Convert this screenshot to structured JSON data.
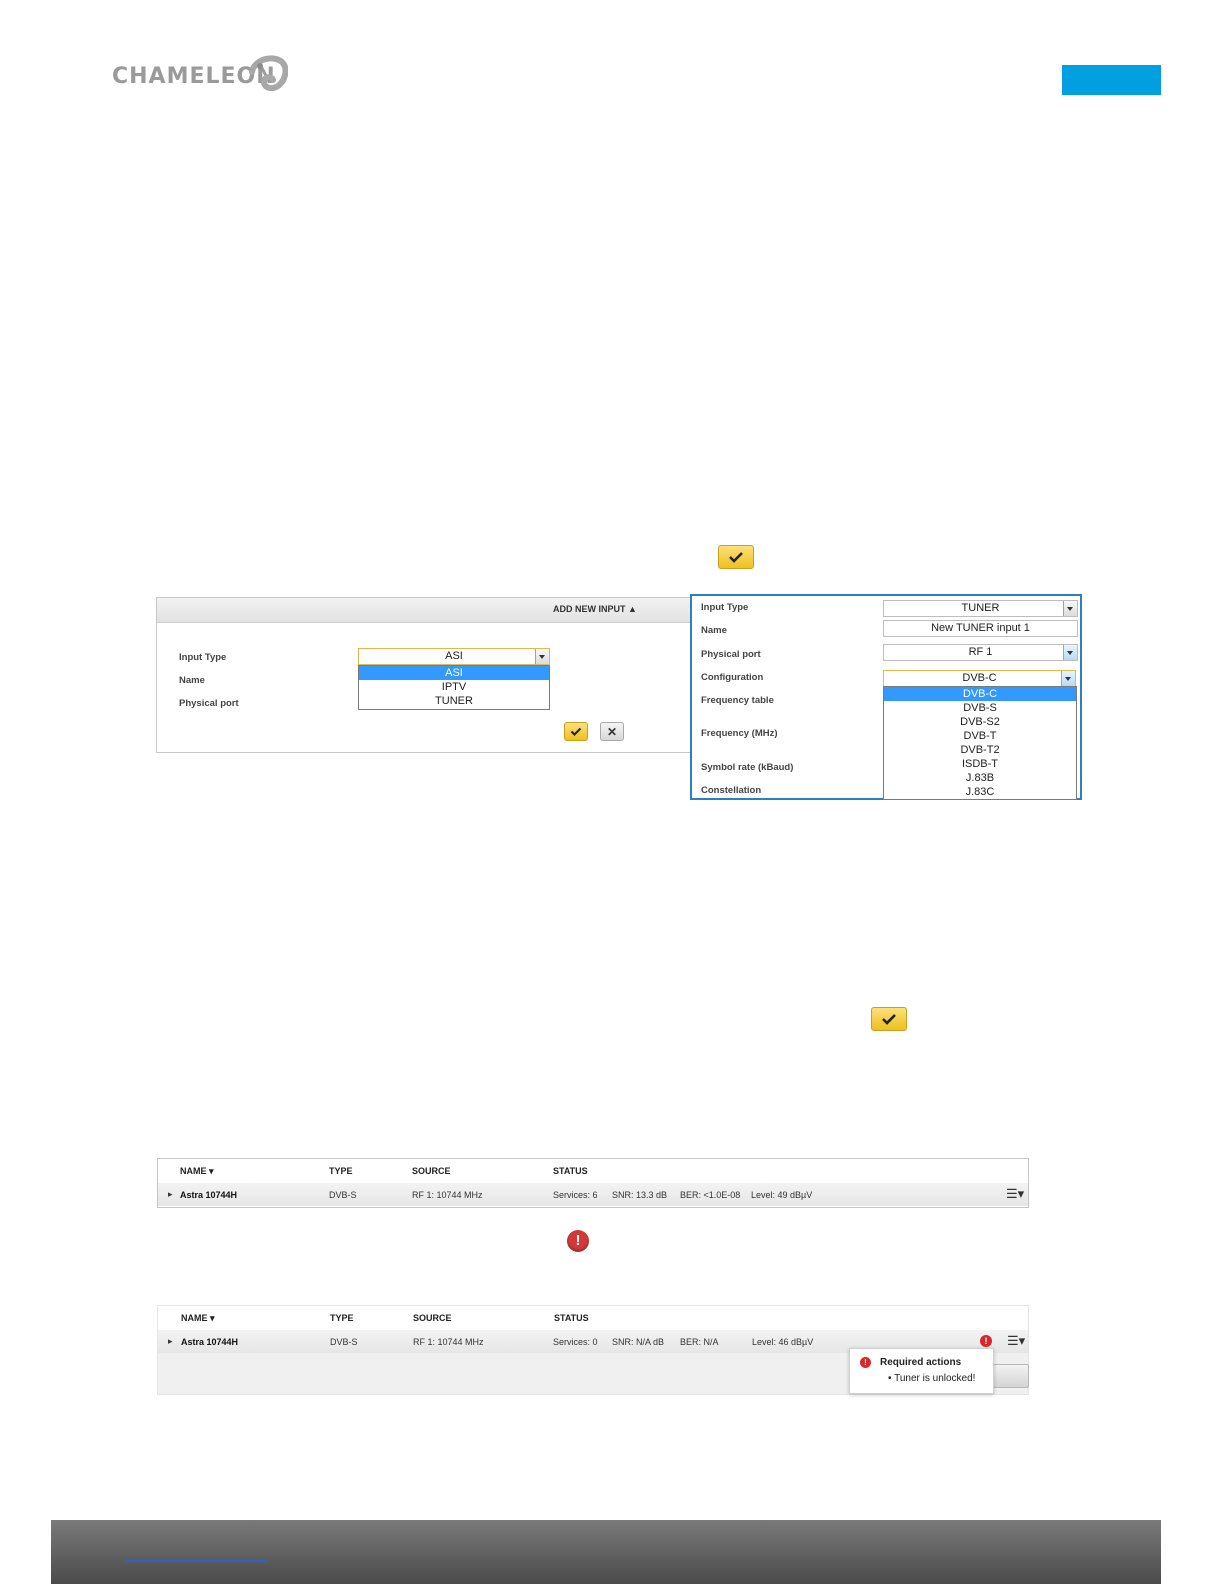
{
  "brand": {
    "logo_text": "CHAMELEON",
    "accent_color": "#00a0e0"
  },
  "add_input_panel": {
    "title": "ADD NEW INPUT ▲",
    "labels": {
      "input_type": "Input Type",
      "name": "Name",
      "physical_port": "Physical port"
    },
    "input_type_value": "ASI",
    "input_type_options": [
      "ASI",
      "IPTV",
      "TUNER"
    ]
  },
  "tuner_panel": {
    "labels": {
      "input_type": "Input Type",
      "name": "Name",
      "physical_port": "Physical port",
      "configuration": "Configuration",
      "frequency_table": "Frequency table",
      "frequency": "Frequency (MHz)",
      "symbol_rate": "Symbol rate (kBaud)",
      "constellation": "Constellation"
    },
    "input_type_value": "TUNER",
    "name_value": "New TUNER input 1",
    "physical_port_value": "RF 1",
    "configuration_value": "DVB-C",
    "configuration_options": [
      "DVB-C",
      "DVB-S",
      "DVB-S2",
      "DVB-T",
      "DVB-T2",
      "ISDB-T",
      "J.83B",
      "J.83C"
    ]
  },
  "table_headers": {
    "name": "NAME ▾",
    "type": "TYPE",
    "source": "SOURCE",
    "status": "STATUS"
  },
  "table_ok": {
    "row": {
      "name": "Astra 10744H",
      "type": "DVB-S",
      "source": "RF 1: 10744 MHz",
      "services": "Services: 6",
      "snr": "SNR: 13.3 dB",
      "ber": "BER: <1.0E-08",
      "level": "Level: 49 dBµV"
    }
  },
  "table_error": {
    "row": {
      "name": "Astra 10744H",
      "type": "DVB-S",
      "source": "RF 1: 10744 MHz",
      "services": "Services: 0",
      "snr": "SNR: N/A dB",
      "ber": "BER: N/A",
      "level": "Level: 46 dBµV"
    },
    "tooltip": {
      "title": "Required actions",
      "item": "Tuner is unlocked!"
    }
  },
  "icons": {
    "confirm": "check-icon",
    "cancel": "close-icon",
    "error": "error-icon",
    "menu": "row-menu-icon",
    "expand": "expand-arrow-icon"
  },
  "glyphs": {
    "error": "!",
    "cancel": "✕",
    "menu": "☰▾",
    "expand": "▸"
  }
}
